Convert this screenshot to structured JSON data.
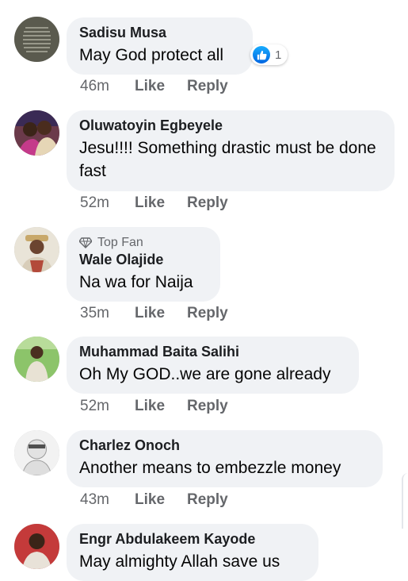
{
  "comments": [
    {
      "name": "Sadisu Musa",
      "badge": "",
      "text": "May God protect all",
      "time": "46m",
      "like": "Like",
      "reply": "Reply",
      "reaction_count": "1",
      "avatar": "avatar-dark-text"
    },
    {
      "name": "Oluwatoyin Egbeyele",
      "badge": "",
      "text": "Jesu!!!! Something drastic must be done fast",
      "time": "52m",
      "like": "Like",
      "reply": "Reply",
      "avatar": "avatar-couple"
    },
    {
      "name": "Wale Olajide",
      "badge": "Top Fan",
      "text": "Na wa for Naija",
      "time": "35m",
      "like": "Like",
      "reply": "Reply",
      "avatar": "avatar-hat-man"
    },
    {
      "name": "Muhammad Baita Salihi",
      "badge": "",
      "text": "Oh My GOD..we are gone already",
      "time": "52m",
      "like": "Like",
      "reply": "Reply",
      "avatar": "avatar-green-field"
    },
    {
      "name": "Charlez Onoch",
      "badge": "",
      "text": "Another means to embezzle money",
      "time": "43m",
      "like": "Like",
      "reply": "Reply",
      "avatar": "avatar-default-gray"
    },
    {
      "name": "Engr Abdulakeem Kayode",
      "badge": "",
      "text": "May almighty Allah save us",
      "avatar": "avatar-red-background"
    }
  ],
  "colors": {
    "bubble": "#f0f2f5",
    "meta": "#65676b",
    "like_reaction": "#1877f2"
  }
}
